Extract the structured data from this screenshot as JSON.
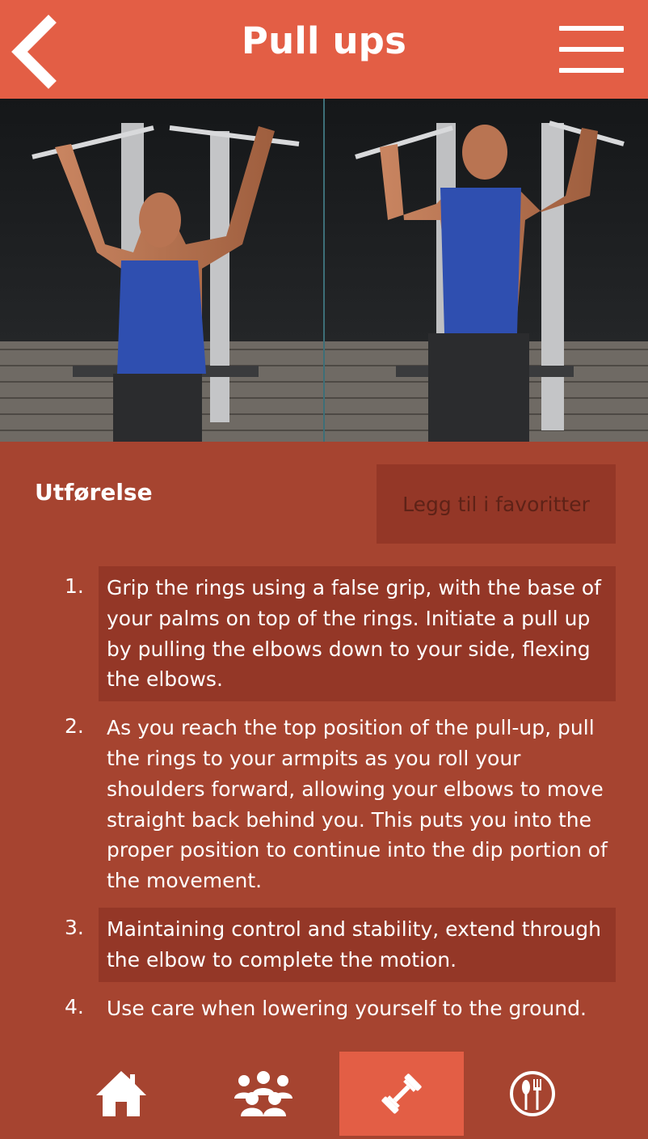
{
  "header": {
    "title": "Pull ups"
  },
  "exercise": {
    "section_heading": "Utførelse",
    "favorite_button": "Legg til i favoritter",
    "steps": [
      {
        "number": "1.",
        "text": "Grip the rings using a false grip, with the base of your palms on top of the rings. Initiate a pull up by pulling the elbows down to your side, flexing the elbows."
      },
      {
        "number": "2.",
        "text": "As you reach the top position of the pull-up, pull the rings to your armpits as you roll your shoulders forward, allowing your elbows to move straight back behind you. This puts you into the proper position to continue into the dip portion of the movement."
      },
      {
        "number": "3.",
        "text": "Maintaining control and stability, extend through the elbow to complete the motion."
      },
      {
        "number": "4.",
        "text": "Use care when lowering yourself to the ground."
      }
    ]
  },
  "nav": {
    "items": [
      {
        "icon": "home-icon",
        "active": false
      },
      {
        "icon": "group-icon",
        "active": false
      },
      {
        "icon": "dumbbell-icon",
        "active": true
      },
      {
        "icon": "restaurant-icon",
        "active": false
      }
    ]
  },
  "colors": {
    "header": "#e35e45",
    "background": "#a64430",
    "shaded_row": "#943727",
    "text": "#ffffff"
  }
}
